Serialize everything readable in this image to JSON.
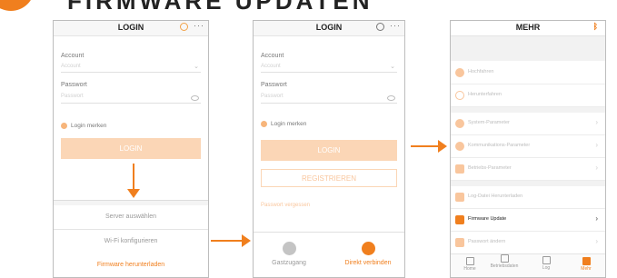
{
  "heading": "FIRMWARE UPDATEN",
  "screen1": {
    "title": "LOGIN",
    "account_label": "Account",
    "account_placeholder": "Account",
    "password_label": "Passwort",
    "password_placeholder": "Passwort",
    "remember_label": "Login merken",
    "login_button": "LOGIN",
    "sheet_items": [
      "Server auswählen",
      "Wi-Fi konfigurieren",
      "Firmware herunterladen"
    ]
  },
  "screen2": {
    "title": "LOGIN",
    "account_label": "Account",
    "account_placeholder": "Account",
    "password_label": "Passwort",
    "password_placeholder": "Passwort",
    "remember_label": "Login merken",
    "login_button": "LOGIN",
    "register_button": "REGISTRIEREN",
    "forgot_password": "Passwort vergessen",
    "guest_label": "Gastzugang",
    "direct_label": "Direkt verbinden"
  },
  "screen3": {
    "title": "MEHR",
    "items": [
      {
        "label": "Hochfahren",
        "icon": "power-on-icon"
      },
      {
        "label": "Herunterfahren",
        "icon": "power-off-icon"
      },
      {
        "label": "System-Parameter",
        "icon": "gear-icon"
      },
      {
        "label": "Kommunikations-Parameter",
        "icon": "communication-icon"
      },
      {
        "label": "Betriebs-Parameter",
        "icon": "parameter-icon"
      },
      {
        "label": "Log-Datei Herunterladen",
        "icon": "log-file-icon"
      },
      {
        "label": "Firmware Update",
        "icon": "firmware-update-icon"
      },
      {
        "label": "Passwort ändern",
        "icon": "lock-icon"
      }
    ],
    "tabs": [
      "Home",
      "Betriebsdaten",
      "Log",
      "Mehr"
    ]
  },
  "colors": {
    "accent": "#f07f1e",
    "accent_light": "#fbd6b6"
  }
}
